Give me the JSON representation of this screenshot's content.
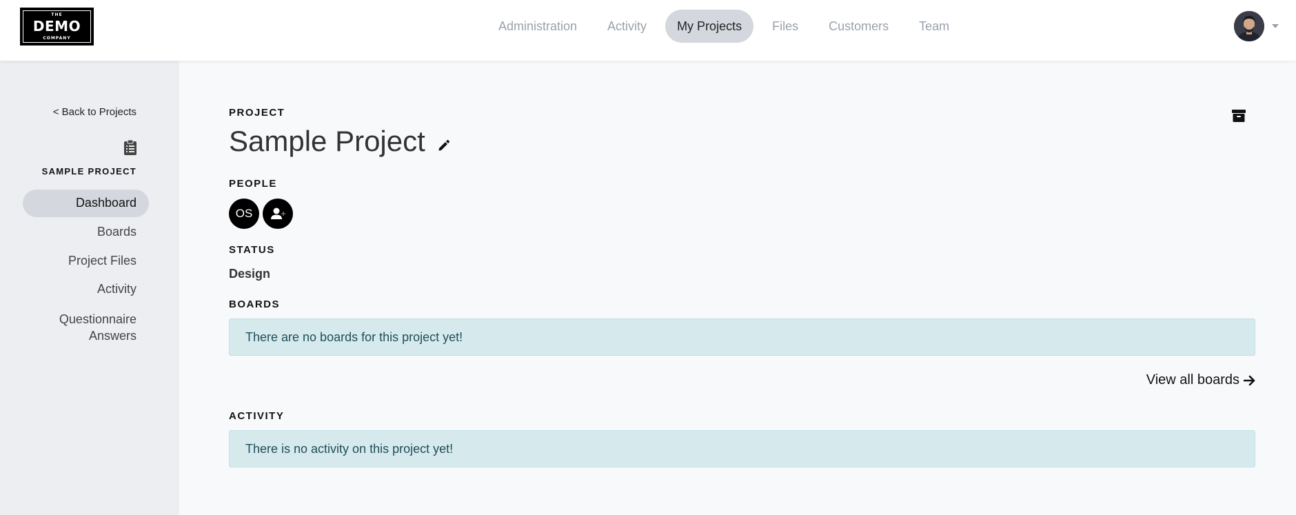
{
  "logo": {
    "line1": "THE",
    "line2": "DEMO",
    "line3": "COMPANY"
  },
  "nav": {
    "items": [
      {
        "label": "Administration",
        "active": false
      },
      {
        "label": "Activity",
        "active": false
      },
      {
        "label": "My Projects",
        "active": true
      },
      {
        "label": "Files",
        "active": false
      },
      {
        "label": "Customers",
        "active": false
      },
      {
        "label": "Team",
        "active": false
      }
    ]
  },
  "sidebar": {
    "back_label": "< Back to Projects",
    "title": "SAMPLE PROJECT",
    "items": [
      {
        "label": "Dashboard"
      },
      {
        "label": "Boards"
      },
      {
        "label": "Project Files"
      },
      {
        "label": "Activity"
      },
      {
        "label": "Questionnaire",
        "label2": "Answers"
      }
    ]
  },
  "project": {
    "section_label": "PROJECT",
    "title": "Sample Project",
    "people_label": "PEOPLE",
    "people": [
      {
        "initials": "OS"
      }
    ],
    "status_label": "STATUS",
    "status_value": "Design",
    "boards_label": "BOARDS",
    "boards_empty": "There are no boards for this project yet!",
    "view_all_label": "View all boards",
    "activity_label": "ACTIVITY",
    "activity_empty": "There is no activity on this project yet!"
  },
  "colors": {
    "active_pill": "#d4d7dd",
    "sidebar_bg": "#eceef1",
    "alert_bg": "#d6eaee",
    "alert_text": "#1f4d5a"
  }
}
